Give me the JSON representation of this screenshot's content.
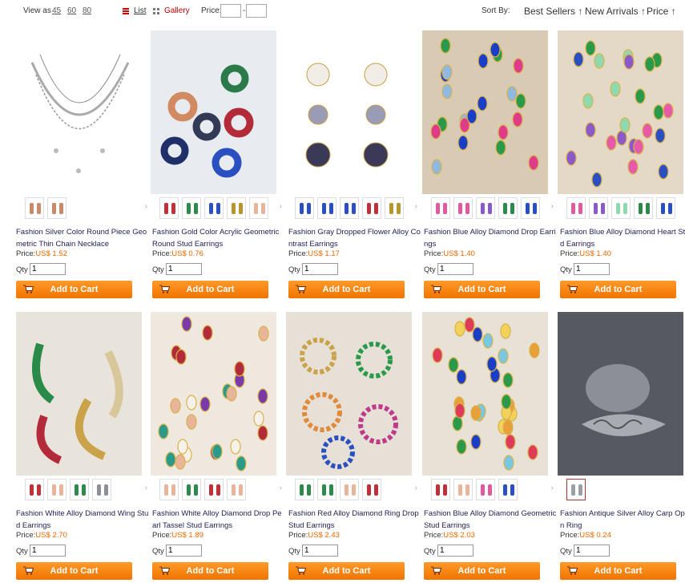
{
  "toolbar": {
    "view_as_label": "View as",
    "view_options": [
      "45",
      "60",
      "80"
    ],
    "list_label": "List",
    "gallery_label": "Gallery",
    "price_label": "Price:",
    "price_separator": "-",
    "price_min": "",
    "price_max": "",
    "sort_by_label": "Sort By:",
    "sort_options": [
      "Best Sellers ↑",
      "New Arrivals ↑",
      "Price ↑"
    ]
  },
  "qty_label": "Qty",
  "price_prefix": "Price:",
  "add_to_cart_label": "Add to Cart",
  "colors": {
    "accent": "#f07400",
    "price": "#e60000",
    "title": "#222255"
  },
  "products": [
    {
      "name": "Fashion Silver Color Round Piece Geometric Thin Chain Necklace",
      "price": "US$ 1.52",
      "qty": "1",
      "image": "silver-layered-necklace",
      "thumbs": [
        "model-earring-thumb",
        "necklace-thumb"
      ]
    },
    {
      "name": "Fashion Gold Color Acrylic Geometric Round Stud Earrings",
      "price": "US$ 0.76",
      "qty": "1",
      "image": "multicolor-ring-earrings",
      "thumbs": [
        "red",
        "green",
        "blue",
        "gold",
        "peach"
      ]
    },
    {
      "name": "Fashion Gray Dropped Flower Alloy Contrast Earrings",
      "price": "US$ 1.17",
      "qty": "1",
      "image": "flower-drop-earrings",
      "thumbs": [
        "blue",
        "blue",
        "blue",
        "red",
        "gold"
      ]
    },
    {
      "name": "Fashion Blue Alloy Diamond Drop Earrings",
      "price": "US$ 1.40",
      "qty": "1",
      "image": "crystal-drop-earrings",
      "thumbs": [
        "pink",
        "pink",
        "purple",
        "green",
        "blue"
      ]
    },
    {
      "name": "Fashion Blue Alloy Diamond Heart Stud Earrings",
      "price": "US$ 1.40",
      "qty": "1",
      "image": "heart-crystal-earrings",
      "thumbs": [
        "pink",
        "purple",
        "mint",
        "green",
        "blue"
      ]
    },
    {
      "name": "Fashion White Alloy Diamond Wing Stud Earrings",
      "price": "US$ 2.70",
      "qty": "1",
      "image": "wing-earrings",
      "thumbs": [
        "red",
        "peach",
        "green",
        "gray"
      ]
    },
    {
      "name": "Fashion White Alloy Diamond Drop Pearl Tassel Stud Earrings",
      "price": "US$ 1.89",
      "qty": "1",
      "image": "pearl-tassel-earrings",
      "thumbs": [
        "peach",
        "green",
        "red",
        "peach"
      ]
    },
    {
      "name": "Fashion Red Alloy Diamond Ring Drop Stud Earrings",
      "price": "US$ 2.43",
      "qty": "1",
      "image": "ring-drop-earrings",
      "thumbs": [
        "green",
        "green",
        "peach",
        "red"
      ]
    },
    {
      "name": "Fashion Blue Alloy Diamond Geometric Stud Earrings",
      "price": "US$ 2.03",
      "qty": "1",
      "image": "geometric-stud-earrings",
      "thumbs": [
        "red",
        "peach",
        "pink",
        "blue"
      ]
    },
    {
      "name": "Fashion Antique Silver Alloy Carp Open Ring",
      "price": "US$ 0.24",
      "qty": "1",
      "image": "carp-ring",
      "thumbs": [
        "silver"
      ]
    }
  ]
}
